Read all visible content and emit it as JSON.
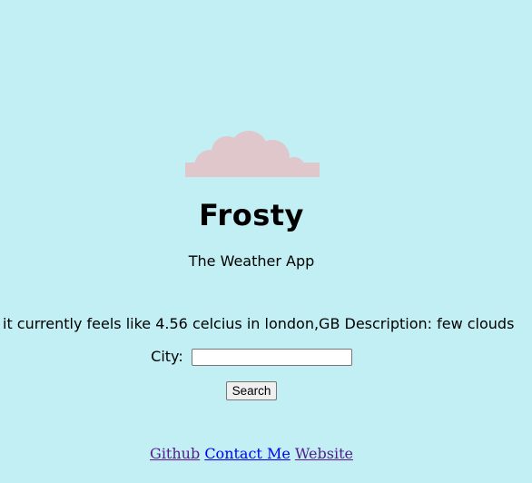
{
  "app": {
    "title": "Frosty",
    "subtitle": "The Weather App"
  },
  "weather": {
    "report": "it currently feels like 4.56 celcius in london,GB Description: few clouds"
  },
  "search": {
    "city_label": "City:",
    "city_value": "",
    "button_label": "Search"
  },
  "footer": {
    "links": [
      "Github",
      "Contact Me",
      "Website"
    ]
  },
  "icons": {
    "logo": "cloud-icon"
  },
  "colors": {
    "background": "#c1eff4",
    "cloud": "#dfc7cc",
    "visited_link": "#551a8b",
    "link": "#0000ee"
  }
}
